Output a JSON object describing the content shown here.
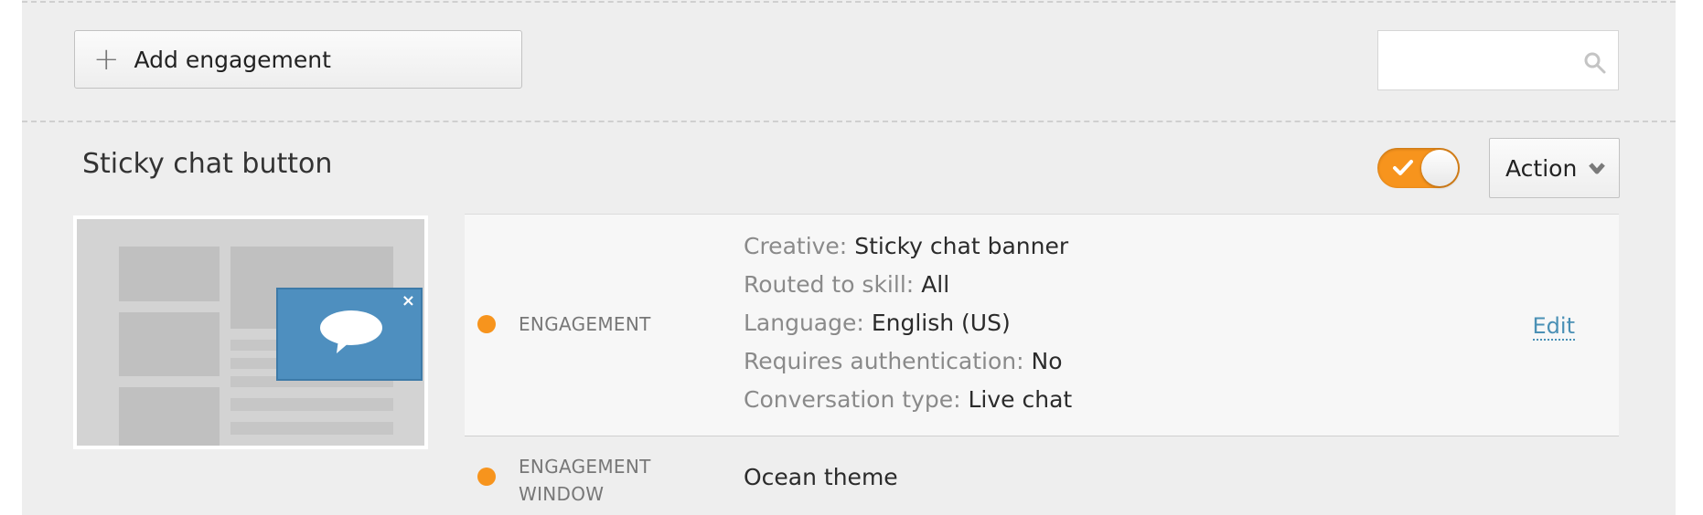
{
  "toolbar": {
    "add_label": "Add engagement",
    "add_icon": "plus-icon",
    "search_value": "",
    "search_icon": "search-icon"
  },
  "section": {
    "title": "Sticky chat button",
    "toggle_on": true,
    "action_label": "Action",
    "action_icon": "chevron-down-icon"
  },
  "colors": {
    "accent": "#f7941d",
    "link": "#4a90b5",
    "bubble": "#4e8fbf"
  },
  "engagements": [
    {
      "type": "ENGAGEMENT",
      "props": [
        {
          "k": "Creative:",
          "v": "Sticky chat banner"
        },
        {
          "k": "Routed to skill:",
          "v": "All"
        },
        {
          "k": "Language:",
          "v": "English (US)"
        },
        {
          "k": "Requires authentication:",
          "v": "No"
        },
        {
          "k": "Conversation type:",
          "v": "Live chat"
        }
      ],
      "edit_label": "Edit"
    },
    {
      "type_line1": "ENGAGEMENT",
      "type_line2": "WINDOW",
      "value": "Ocean theme"
    }
  ],
  "preview": {
    "close_glyph": "×"
  }
}
